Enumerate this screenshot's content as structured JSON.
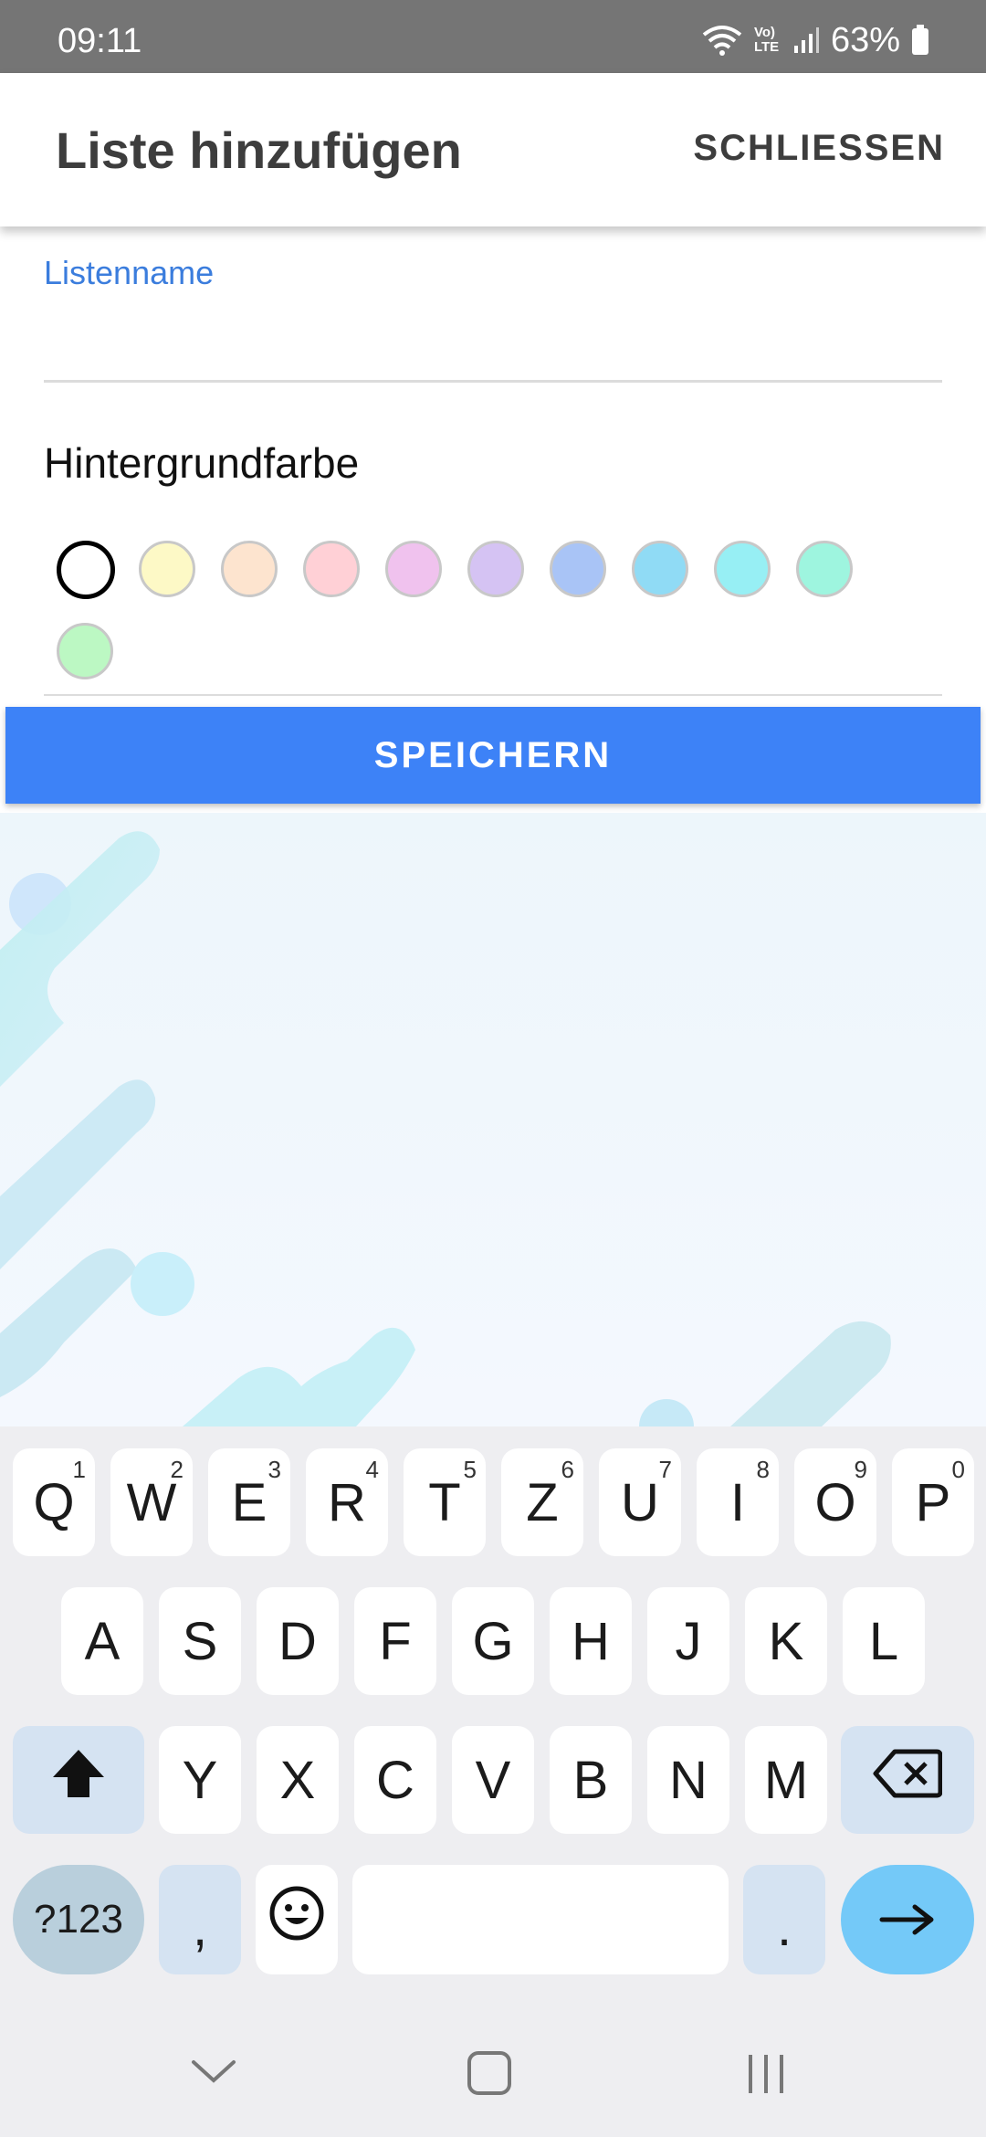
{
  "status_bar": {
    "time": "09:11",
    "network": "Vo) LTE",
    "battery": "63%"
  },
  "app_bar": {
    "title": "Liste hinzufügen",
    "close_label": "SCHLIESSEN"
  },
  "form": {
    "name_label": "Listenname",
    "name_value": "",
    "color_section_title": "Hintergrundfarbe",
    "colors": [
      "#ffffff",
      "#fdf9c6",
      "#fde4cf",
      "#ffd0d6",
      "#f0c2ee",
      "#d5c3f3",
      "#a9c4f6",
      "#90dbf5",
      "#97eff4",
      "#9ef5df",
      "#bcf8c3"
    ],
    "selected_color": "#ffffff",
    "save_label": "SPEICHERN"
  },
  "keyboard": {
    "row1": [
      {
        "key": "Q",
        "sub": "1"
      },
      {
        "key": "W",
        "sub": "2"
      },
      {
        "key": "E",
        "sub": "3"
      },
      {
        "key": "R",
        "sub": "4"
      },
      {
        "key": "T",
        "sub": "5"
      },
      {
        "key": "Z",
        "sub": "6"
      },
      {
        "key": "U",
        "sub": "7"
      },
      {
        "key": "I",
        "sub": "8"
      },
      {
        "key": "O",
        "sub": "9"
      },
      {
        "key": "P",
        "sub": "0"
      }
    ],
    "row2": [
      "A",
      "S",
      "D",
      "F",
      "G",
      "H",
      "J",
      "K",
      "L"
    ],
    "row3": [
      "Y",
      "X",
      "C",
      "V",
      "B",
      "N",
      "M"
    ],
    "symbols_label": "?123",
    "comma": ",",
    "period": ".",
    "shift_icon": "shift-icon",
    "backspace_icon": "backspace-icon",
    "emoji_icon": "emoji-icon",
    "enter_icon": "arrow-right-icon"
  },
  "nav_bar": {
    "back_icon": "chevron-down-icon",
    "home_icon": "home-square-icon",
    "recents_icon": "recents-icon"
  }
}
